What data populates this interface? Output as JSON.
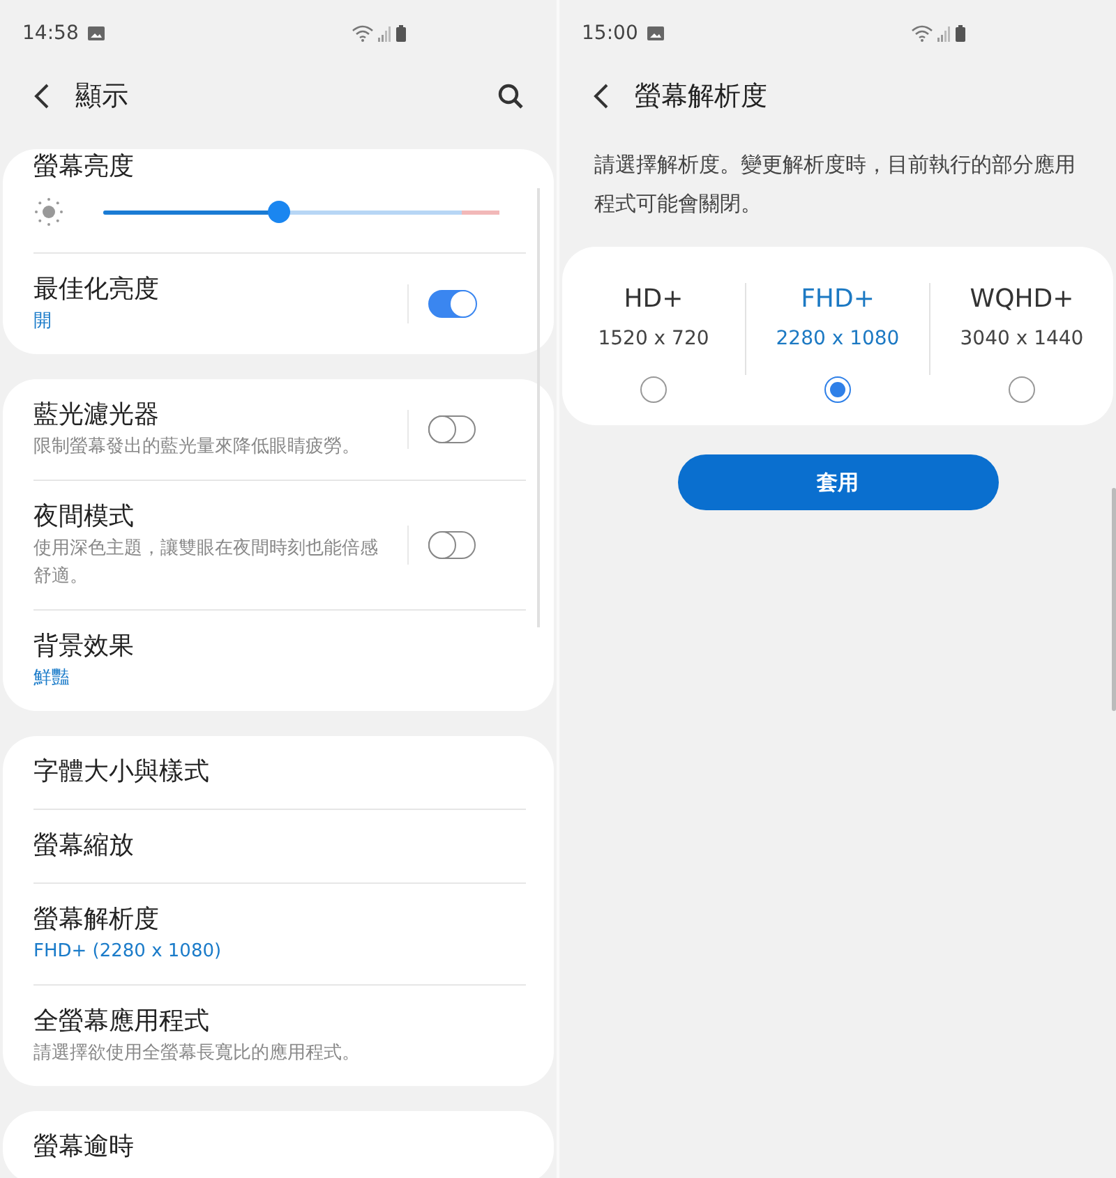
{
  "left_screen": {
    "status_bar": {
      "time": "14:58"
    },
    "header": {
      "title": "顯示"
    },
    "groups": [
      [
        {
          "kind": "slider",
          "title": "螢幕亮度",
          "level": 0.42
        },
        {
          "kind": "toggle",
          "title": "最佳化亮度",
          "value": "開",
          "on": true
        }
      ],
      [
        {
          "kind": "toggle",
          "title": "藍光濾光器",
          "description": "限制螢幕發出的藍光量來降低眼睛疲勞。",
          "on": false
        },
        {
          "kind": "toggle",
          "title": "夜間模式",
          "description": "使用深色主題，讓雙眼在夜間時刻也能倍感舒適。",
          "on": false
        },
        {
          "kind": "link",
          "title": "背景效果",
          "value": "鮮豔"
        }
      ],
      [
        {
          "kind": "link",
          "title": "字體大小與樣式"
        },
        {
          "kind": "link",
          "title": "螢幕縮放"
        },
        {
          "kind": "link",
          "title": "螢幕解析度",
          "value": "FHD+ (2280 x 1080)"
        },
        {
          "kind": "link",
          "title": "全螢幕應用程式",
          "description": "請選擇欲使用全螢幕長寬比的應用程式。"
        }
      ],
      [
        {
          "kind": "link",
          "title": "螢幕逾時"
        }
      ]
    ]
  },
  "right_screen": {
    "status_bar": {
      "time": "15:00"
    },
    "header": {
      "title": "螢幕解析度"
    },
    "description": "請選擇解析度。變更解析度時，目前執行的部分應用程式可能會關閉。",
    "options": [
      {
        "name": "HD+",
        "resolution": "1520 x 720",
        "selected": false
      },
      {
        "name": "FHD+",
        "resolution": "2280 x 1080",
        "selected": true
      },
      {
        "name": "WQHD+",
        "resolution": "3040 x 1440",
        "selected": false
      }
    ],
    "button": "套用"
  }
}
